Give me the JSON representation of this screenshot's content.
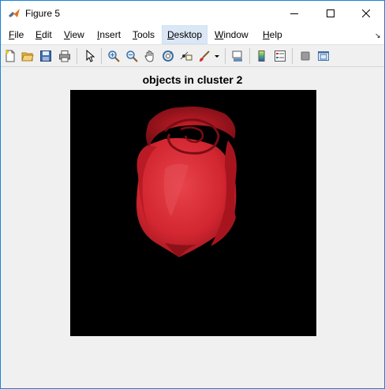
{
  "window": {
    "title": "Figure 5",
    "minimize_icon": "minimize-icon",
    "maximize_icon": "maximize-icon",
    "close_icon": "close-icon"
  },
  "menubar": {
    "items": [
      {
        "label": "File",
        "mnemonic": "F",
        "rest": "ile"
      },
      {
        "label": "Edit",
        "mnemonic": "E",
        "rest": "dit"
      },
      {
        "label": "View",
        "mnemonic": "V",
        "rest": "iew"
      },
      {
        "label": "Insert",
        "mnemonic": "I",
        "rest": "nsert"
      },
      {
        "label": "Tools",
        "mnemonic": "T",
        "rest": "ools"
      },
      {
        "label": "Desktop",
        "mnemonic": "D",
        "rest": "esktop"
      },
      {
        "label": "Window",
        "mnemonic": "W",
        "rest": "indow"
      },
      {
        "label": "Help",
        "mnemonic": "H",
        "rest": "elp"
      }
    ],
    "active_item": "Desktop"
  },
  "toolbar": {
    "buttons": [
      "new-figure-icon",
      "open-file-icon",
      "save-icon",
      "print-icon",
      "pointer-icon",
      "zoom-in-icon",
      "zoom-out-icon",
      "pan-icon",
      "rotate-icon",
      "data-cursor-icon",
      "brush-icon",
      "link-icon",
      "colorbar-icon",
      "legend-icon",
      "hide-plot-tools-icon",
      "show-plot-tools-icon"
    ]
  },
  "figure": {
    "title": "objects in cluster 2",
    "image_subject": "red rose bud on black background"
  },
  "colors": {
    "accent": "#1883d7",
    "axes_background": "#000000",
    "rose": "#d42a33"
  }
}
